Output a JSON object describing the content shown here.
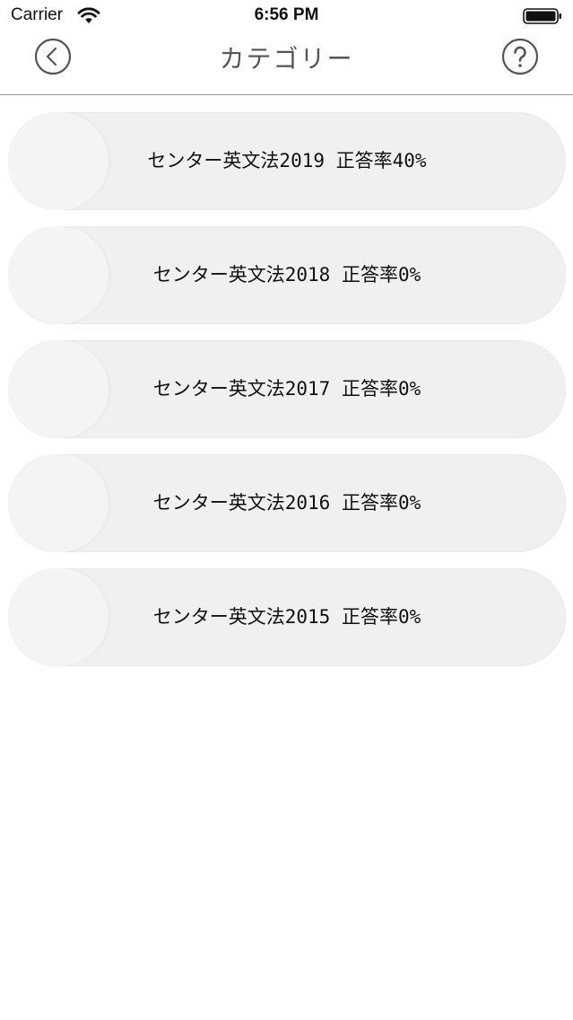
{
  "status_bar": {
    "carrier": "Carrier",
    "time": "6:56 PM",
    "wifi_icon": "wifi-icon",
    "battery_icon": "battery-icon"
  },
  "nav": {
    "title": "カテゴリー",
    "back_icon": "chevron-left-circle-icon",
    "help_icon": "question-circle-icon"
  },
  "categories": [
    {
      "label": "センター英文法2019 正答率40%"
    },
    {
      "label": "センター英文法2018 正答率0%"
    },
    {
      "label": "センター英文法2017 正答率0%"
    },
    {
      "label": "センター英文法2016 正答率0%"
    },
    {
      "label": "センター英文法2015 正答率0%"
    }
  ],
  "colors": {
    "item_bg": "#f0eff2",
    "divider": "#9a9a9a",
    "title_text": "#555555",
    "icon_stroke": "#555555"
  }
}
